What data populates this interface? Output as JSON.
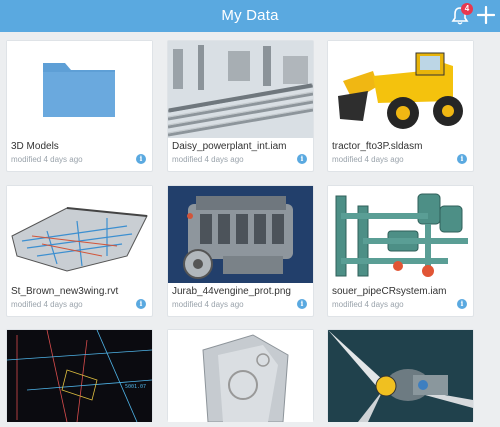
{
  "header": {
    "title": "My Data",
    "notification_count": "4",
    "accent": "#5aa9e0"
  },
  "items": [
    {
      "name": "3D Models",
      "modified": "modified 4 days ago",
      "kind": "folder"
    },
    {
      "name": "Daisy_powerplant_int.iam",
      "modified": "modified 4 days ago",
      "kind": "pipes"
    },
    {
      "name": "tractor_fto3P.sldasm",
      "modified": "modified 4 days ago",
      "kind": "loader"
    },
    {
      "name": "St_Brown_new3wing.rvt",
      "modified": "modified 4 days ago",
      "kind": "building"
    },
    {
      "name": "Jurab_44vengine_prot.png",
      "modified": "modified 4 days ago",
      "kind": "engine"
    },
    {
      "name": "souer_pipeCRsystem.iam",
      "modified": "modified 4 days ago",
      "kind": "pipesys"
    },
    {
      "kind": "cad"
    },
    {
      "kind": "block"
    },
    {
      "kind": "turbine"
    }
  ]
}
